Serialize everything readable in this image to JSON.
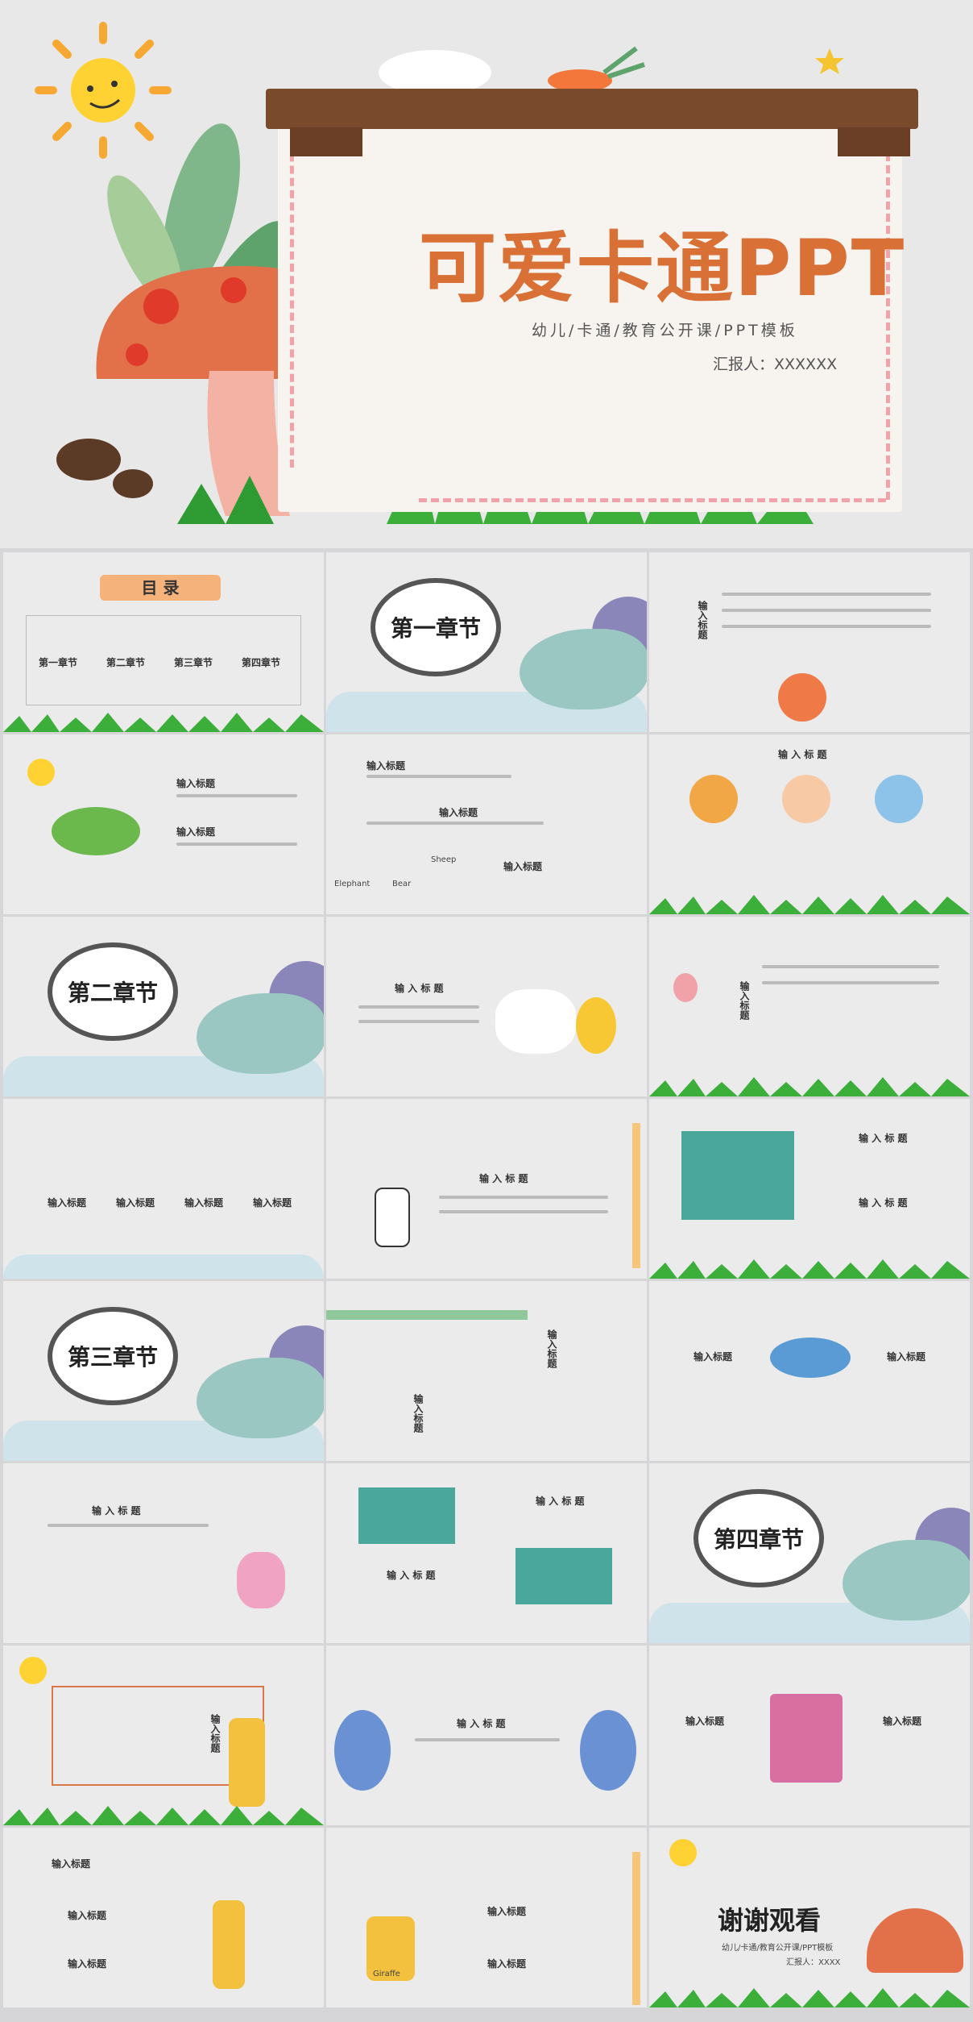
{
  "hero": {
    "title": "可爱卡通PPT",
    "subtitle": "幼儿/卡通/教育公开课/PPT模板",
    "reporter": "汇报人：XXXXXX"
  },
  "toc": {
    "title": "目 录",
    "items": [
      "第一章节",
      "第二章节",
      "第三章节",
      "第四章节"
    ]
  },
  "chapters": [
    "第一章节",
    "第二章节",
    "第三章节",
    "第四章节"
  ],
  "common": {
    "input_title": "输入标题",
    "input_title_spaced": "输 入 标 题"
  },
  "end": {
    "title": "谢谢观看",
    "subtitle": "幼儿/卡通/教育公开课/PPT模板",
    "reporter": "汇报人：XXXX"
  },
  "labels": {
    "elephant": "Elephant",
    "bear": "Bear",
    "sheep": "Sheep",
    "giraffe": "Giraffe"
  },
  "colors": {
    "title_orange": "#d97036",
    "wood": "#7a4a2d",
    "grass": "#3cae3a",
    "background": "#ebebeb"
  }
}
